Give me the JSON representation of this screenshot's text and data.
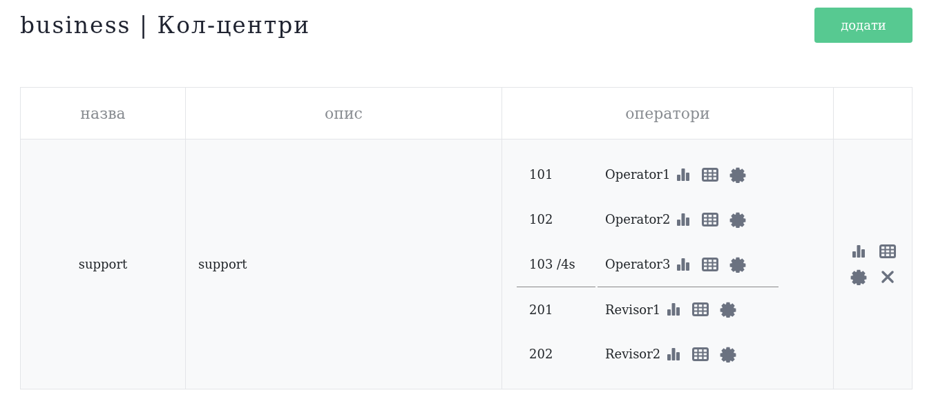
{
  "title": "business | Кол-центри",
  "add_button": "додати",
  "table": {
    "columns": [
      "назва",
      "опис",
      "оператори"
    ],
    "rows": [
      {
        "name": "support",
        "description": "support",
        "operator_groups": [
          {
            "operators": [
              {
                "extension": "101",
                "name": "Operator1"
              },
              {
                "extension": "102",
                "name": "Operator2"
              },
              {
                "extension": "103 /4s",
                "name": "Operator3"
              }
            ]
          },
          {
            "operators": [
              {
                "extension": "201",
                "name": "Revisor1"
              },
              {
                "extension": "202",
                "name": "Revisor2"
              }
            ]
          }
        ]
      }
    ]
  }
}
